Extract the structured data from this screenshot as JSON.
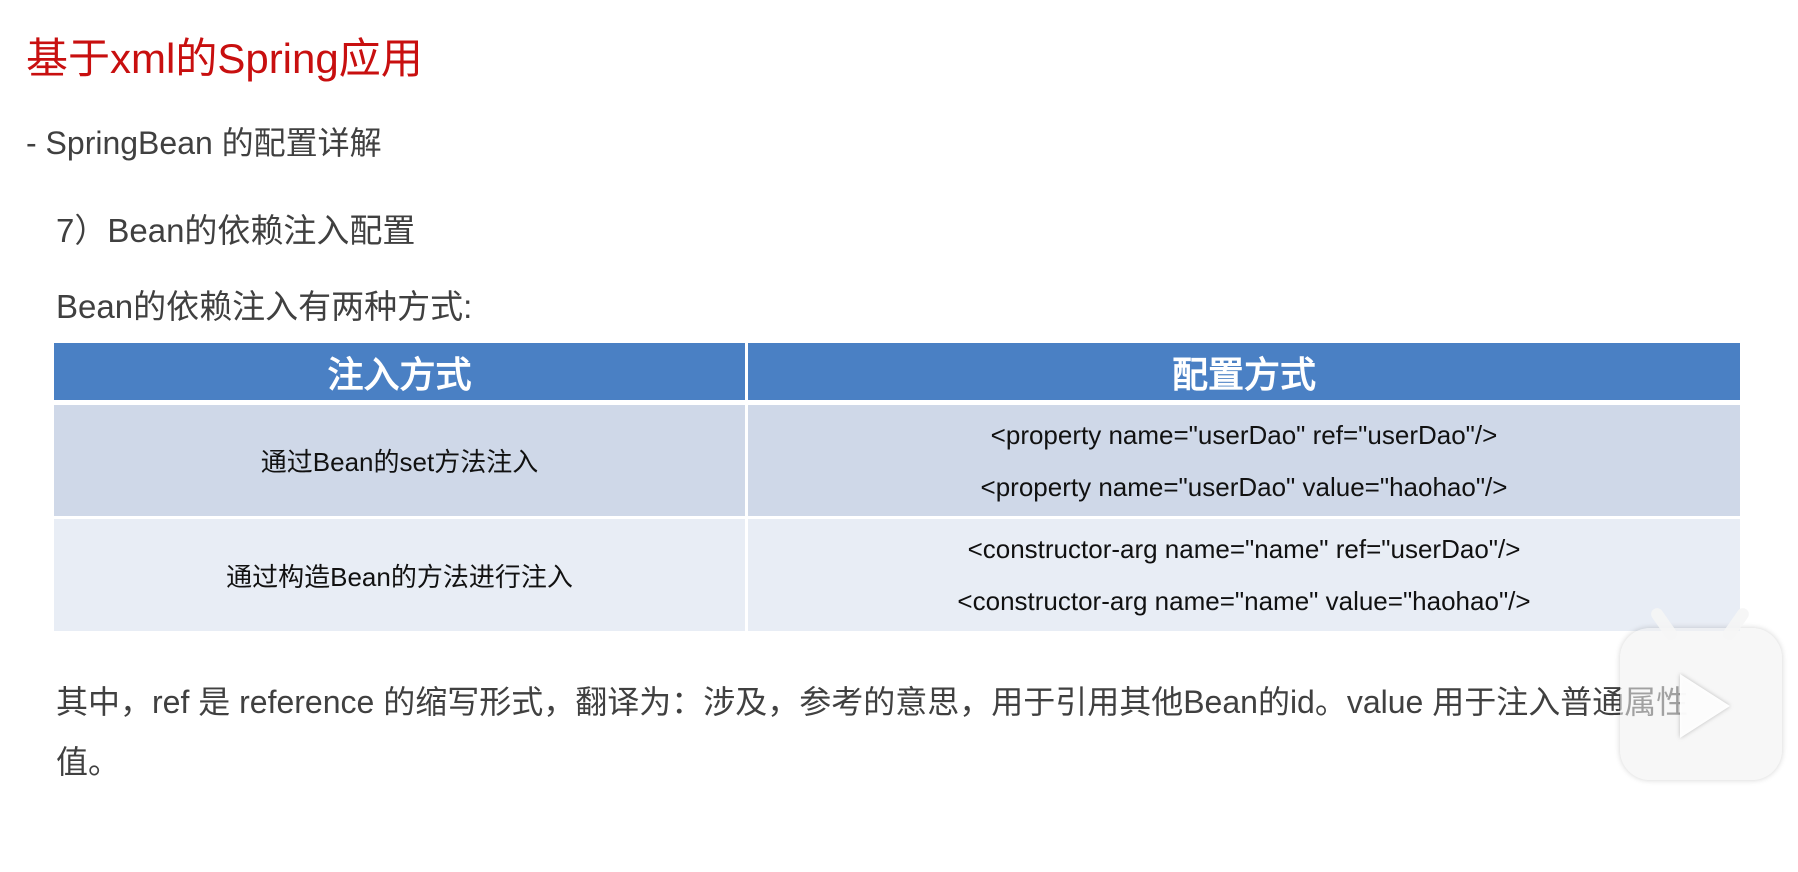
{
  "title": "基于xml的Spring应用",
  "subtitle": "- SpringBean 的配置详解",
  "section": "7）Bean的依赖注入配置",
  "intro": "Bean的依赖注入有两种方式:",
  "table": {
    "headers": [
      "注入方式",
      "配置方式"
    ],
    "rows": [
      {
        "method": "通过Bean的set方法注入",
        "config": [
          "<property name=\"userDao\" ref=\"userDao\"/>",
          "<property name=\"userDao\" value=\"haohao\"/>"
        ]
      },
      {
        "method": "通过构造Bean的方法进行注入",
        "config": [
          "<constructor-arg name=\"name\" ref=\"userDao\"/>",
          "<constructor-arg name=\"name\" value=\"haohao\"/>"
        ]
      }
    ]
  },
  "note": "其中，ref 是 reference 的缩写形式，翻译为：涉及，参考的意思，用于引用其他Bean的id。value 用于注入普通属性值。",
  "overlay": {
    "icon": "video-play-icon"
  }
}
